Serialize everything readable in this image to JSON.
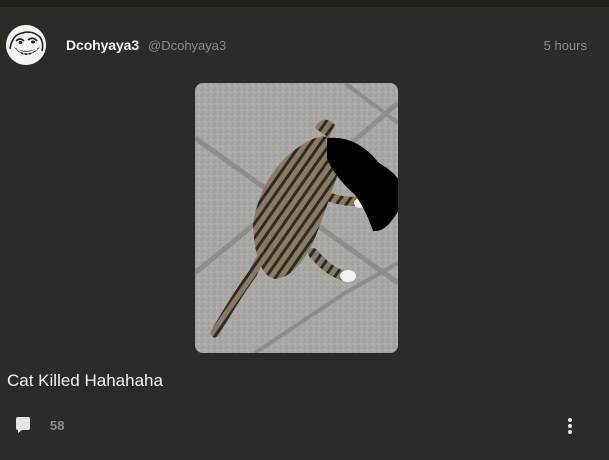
{
  "post": {
    "display_name": "Dcohyaya3",
    "handle": "@Dcohyaya3",
    "timestamp": "5 hours",
    "text": "Cat Killed Hahahaha",
    "media": {
      "subject": "photo of a tabby cat lying on paving stones, head blacked out"
    },
    "actions": {
      "comment_icon": "comment-bubble-icon",
      "comment_count": "58",
      "more_icon": "vertical-ellipsis-icon"
    }
  },
  "colors": {
    "page_background": "#1c1c1c",
    "post_background": "#2b2b28",
    "primary_text": "#f2f2f2",
    "muted_text": "#8a8a86"
  }
}
